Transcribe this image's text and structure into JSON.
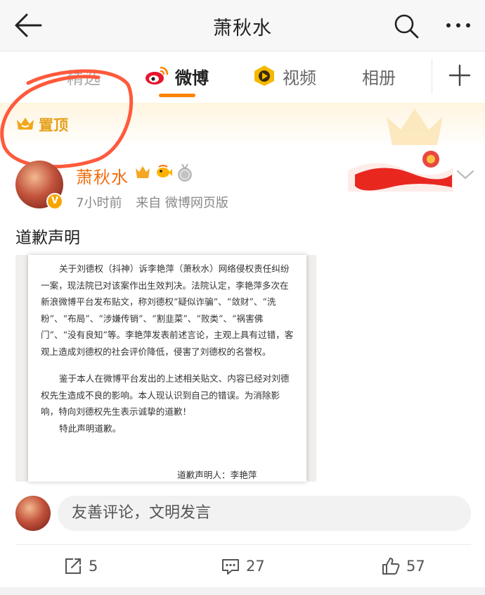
{
  "header": {
    "title": "萧秋水",
    "back_icon": "arrow-left-icon",
    "search_icon": "search-icon",
    "more_icon": "more-horizontal-icon"
  },
  "tabs": [
    {
      "label": "精选",
      "active": false
    },
    {
      "label": "微博",
      "active": true,
      "icon": "weibo-logo-icon"
    },
    {
      "label": "视频",
      "active": false,
      "icon": "video-icon"
    },
    {
      "label": "相册",
      "active": false
    }
  ],
  "tab_add_icon": "plus-icon",
  "pinned": {
    "label": "置顶",
    "icon": "crown-icon"
  },
  "post": {
    "author": "萧秋水",
    "verified_badge": "V",
    "time": "7小时前",
    "source": "来自 微博网页版",
    "text": "道歉声明",
    "image_doc": {
      "paragraphs": [
        "关于刘德权（抖神）诉李艳萍（萧秋水）网络侵权责任纠纷一案，现法院已对该案作出生效判决。法院认定，李艳萍多次在新浪微博平台发布贴文，称刘德权“疑似诈骗”、“敛财”、“洗粉”、“布局”、“涉嫌传销”、“割韭菜”、“败类”、“祸害佛门”、“没有良知”等。李艳萍发表前述言论，主观上具有过错，客观上造成刘德权的社会评价降低，侵害了刘德权的名誉权。",
        "鉴于本人在微博平台发出的上述相关贴文、内容已经对刘德权先生造成不良的影响。本人现认识到自己的错误。为消除影响，特向刘德权先生表示诚挚的道歉！",
        "特此声明道歉。"
      ],
      "signature": "道歉声明人：李艳萍"
    }
  },
  "comment": {
    "placeholder": "友善评论，文明发言"
  },
  "actions": {
    "repost_count": "5",
    "comment_count": "27",
    "like_count": "57"
  },
  "colors": {
    "accent": "#ff8200",
    "username": "#f26b0f",
    "pinned_gold": "#e6a019",
    "annotation_red": "#ff5a3c"
  }
}
